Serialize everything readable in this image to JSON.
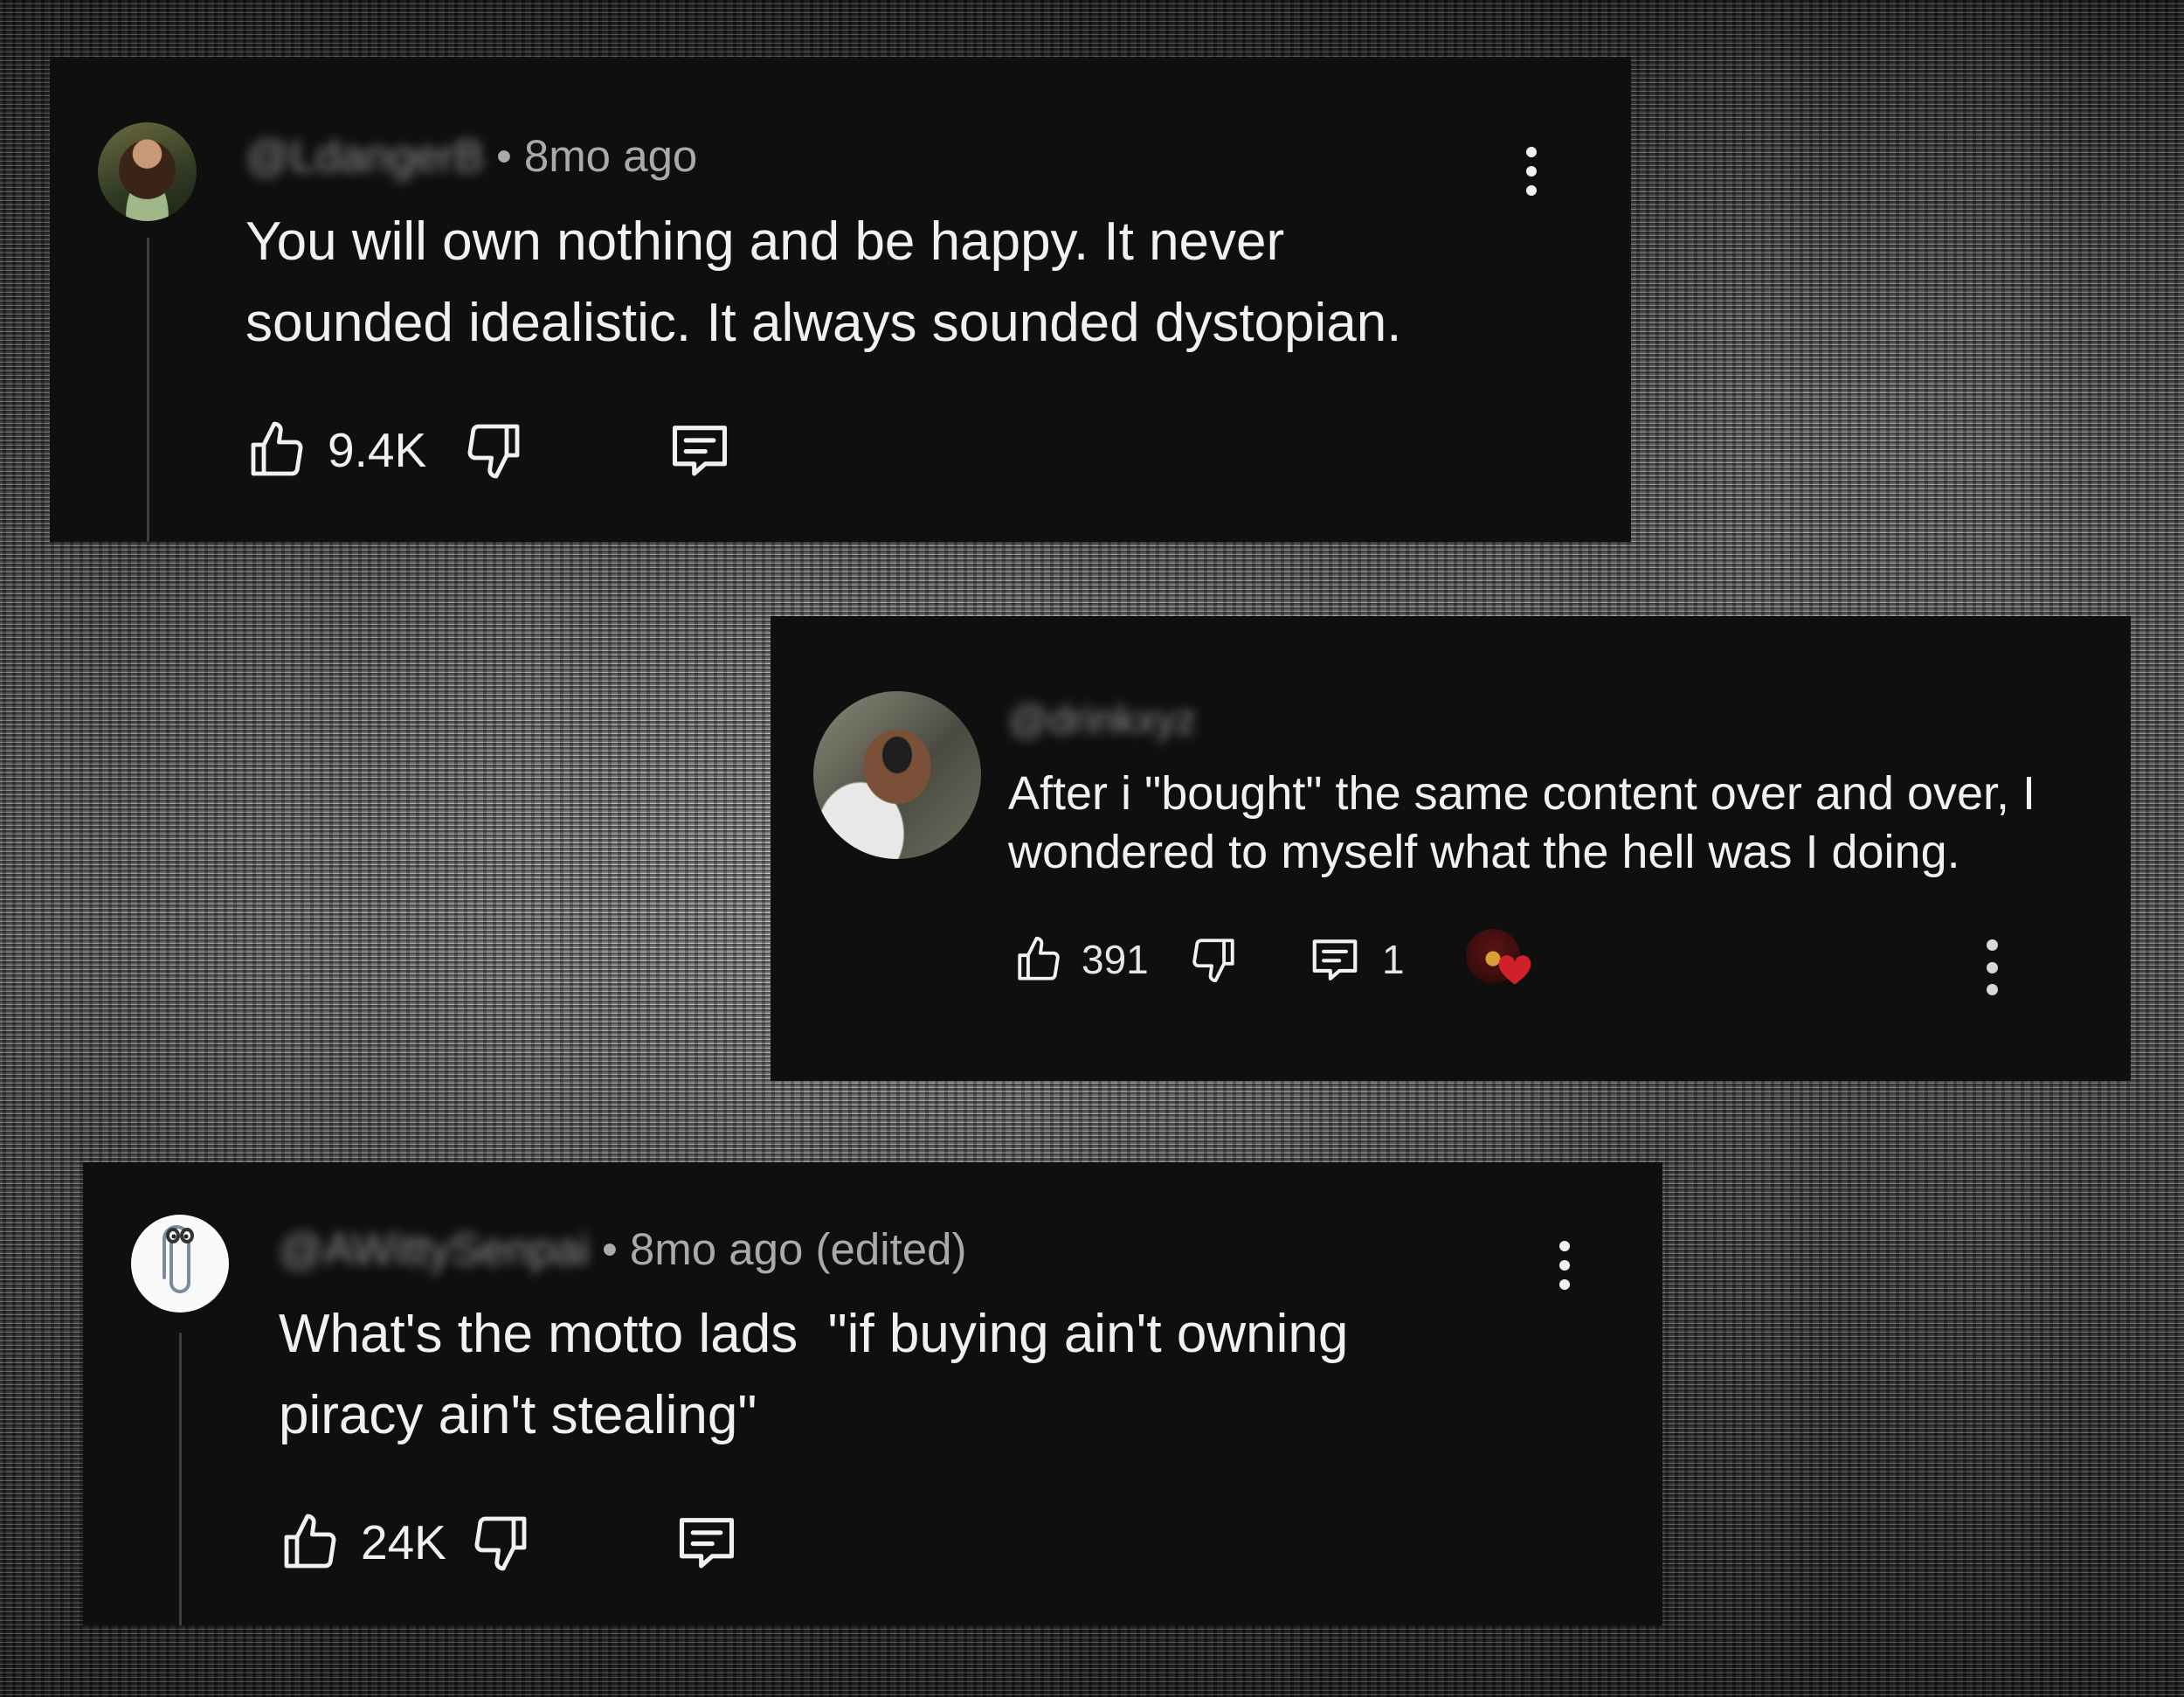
{
  "comments": [
    {
      "handle": "@LdangerB",
      "time": "8mo ago",
      "text": "You will own nothing and be happy. It never\nsounded idealistic. It always sounded dystopian.",
      "likes": "9.4K",
      "replies": ""
    },
    {
      "handle": "@drinkxyz",
      "time": "",
      "text": "After i \"bought\" the same content over and over, I\nwondered to myself what the hell was I doing.",
      "likes": "391",
      "replies": "1"
    },
    {
      "handle": "@AWittySenpai",
      "time": "8mo ago (edited)",
      "text": "What's the motto lads  \"if buying ain't owning\npiracy ain't stealing\"",
      "likes": "24K",
      "replies": ""
    }
  ],
  "icons": {
    "like": "thumbs-up-icon",
    "dislike": "thumbs-down-icon",
    "reply": "reply-bubble-icon",
    "more": "more-vertical-icon",
    "creator_heart": "creator-heart-icon"
  },
  "colors": {
    "card_bg": "#0f0f10",
    "text": "#f1f1f1",
    "meta_text": "#aaaaaa",
    "heart": "#d0202a"
  }
}
